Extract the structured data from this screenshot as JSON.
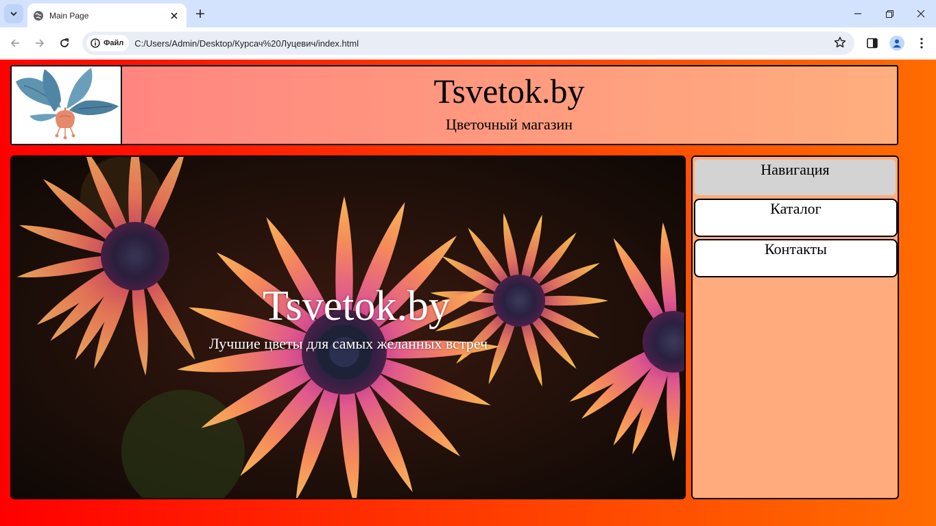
{
  "browser": {
    "tab_title": "Main Page",
    "security_chip": "Файл",
    "url": "C:/Users/Admin/Desktop/Курсач%20Луцевич/index.html"
  },
  "header": {
    "title": "Tsvetok.by",
    "subtitle": "Цветочный магазин"
  },
  "hero": {
    "title": "Tsvetok.by",
    "subtitle": "Лучшие цветы для самых желанных встреч"
  },
  "sidebar": {
    "heading": "Навигация",
    "items": [
      {
        "label": "Каталог"
      },
      {
        "label": "Контакты"
      }
    ]
  },
  "colors": {
    "page_gradient_start": "#ff0000",
    "page_gradient_end": "#ff6c00",
    "header_gradient_start": "#ff8080",
    "header_gradient_end": "#ffae7e",
    "sidebar_bg": "#ffab7e",
    "nav_heading_bg": "#d3d3d3"
  },
  "icons": {
    "tab_search": "chevron-down-icon",
    "favicon": "globe-icon",
    "info": "info-icon",
    "bookmark": "star-icon",
    "side_panel": "side-panel-icon",
    "profile": "profile-icon",
    "menu": "kebab-menu-icon"
  }
}
